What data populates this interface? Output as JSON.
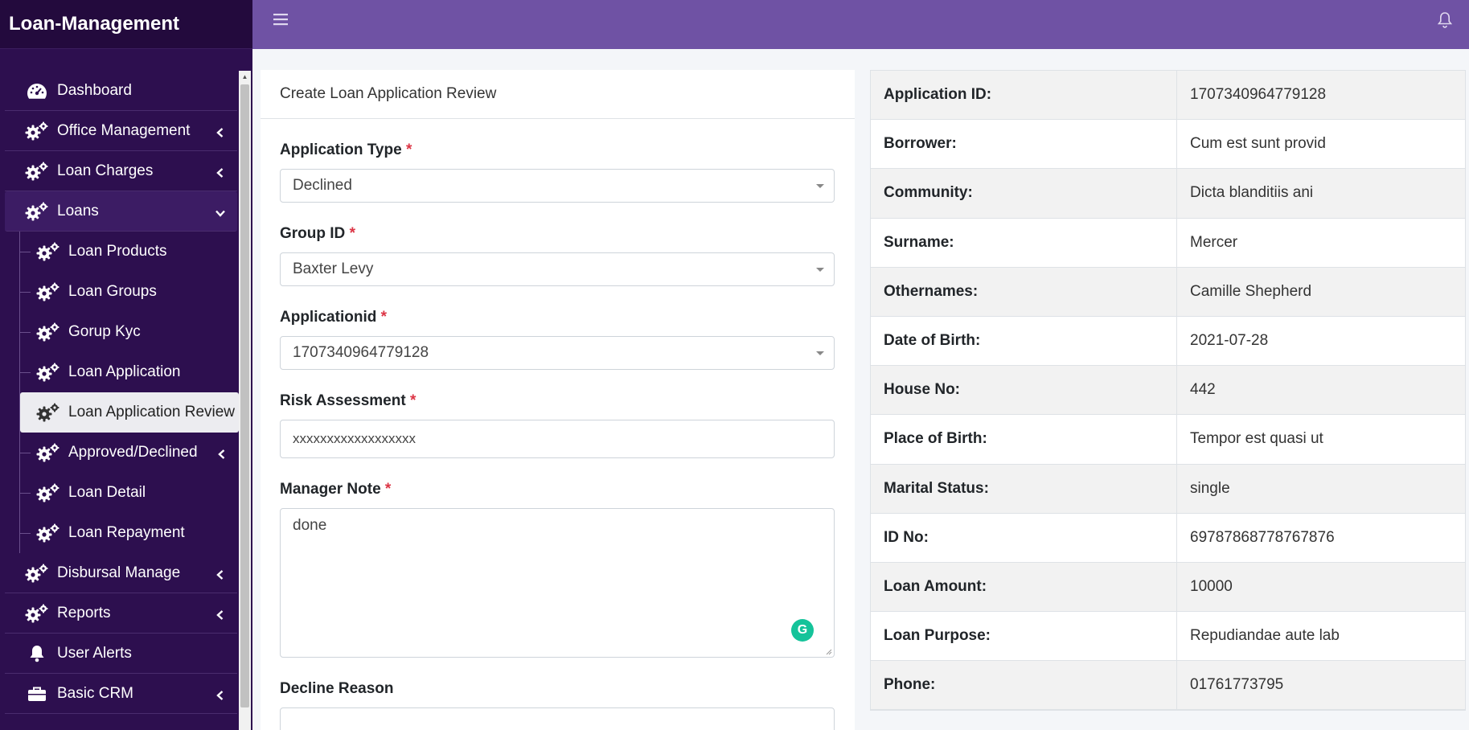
{
  "brand": "Loan-Management",
  "sidebar": {
    "dashboard": "Dashboard",
    "office_management": "Office Management",
    "loan_charges": "Loan Charges",
    "loans": "Loans",
    "loan_products": "Loan Products",
    "loan_groups": "Loan Groups",
    "gorup_kyc": "Gorup Kyc",
    "loan_application": "Loan Application",
    "loan_application_review": "Loan Application Review",
    "approved_declined": "Approved/Declined",
    "loan_detail": "Loan Detail",
    "loan_repayment": "Loan Repayment",
    "disbursal_manage": "Disbursal Manage",
    "reports": "Reports",
    "user_alerts": "User Alerts",
    "basic_crm": "Basic CRM"
  },
  "form": {
    "title": "Create Loan Application Review",
    "required_mark": "*",
    "application_type_label": "Application Type",
    "application_type_value": "Declined",
    "group_id_label": "Group ID",
    "group_id_value": "Baxter Levy",
    "applicationid_label": "Applicationid",
    "applicationid_value": "1707340964779128",
    "risk_label": "Risk Assessment",
    "risk_value": "xxxxxxxxxxxxxxxxxx",
    "manager_note_label": "Manager Note",
    "manager_note_value": "done",
    "decline_reason_label": "Decline Reason"
  },
  "details": [
    {
      "key": "Application ID:",
      "value": "1707340964779128"
    },
    {
      "key": "Borrower:",
      "value": "Cum est sunt provid"
    },
    {
      "key": "Community:",
      "value": "Dicta blanditiis ani"
    },
    {
      "key": "Surname:",
      "value": "Mercer"
    },
    {
      "key": "Othernames:",
      "value": "Camille Shepherd"
    },
    {
      "key": "Date of Birth:",
      "value": "2021-07-28"
    },
    {
      "key": "House No:",
      "value": "442"
    },
    {
      "key": "Place of Birth:",
      "value": "Tempor est quasi ut"
    },
    {
      "key": "Marital Status:",
      "value": "single"
    },
    {
      "key": "ID No:",
      "value": "69787868778767876"
    },
    {
      "key": "Loan Amount:",
      "value": "10000"
    },
    {
      "key": "Loan Purpose:",
      "value": "Repudiandae aute lab"
    },
    {
      "key": "Phone:",
      "value": "01761773795"
    }
  ],
  "colors": {
    "sidebar_bg": "#2d0f4f",
    "topbar_bg": "#6f52a4",
    "required": "#dc3545"
  }
}
